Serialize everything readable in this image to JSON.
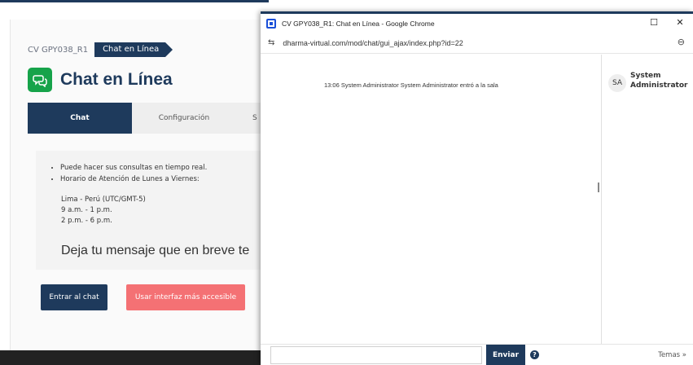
{
  "background_page": {
    "breadcrumb": [
      "CV GPY038_R1",
      "Chat en Línea"
    ],
    "title": "Chat en Línea",
    "tabs": [
      "Chat",
      "Configuración",
      "S"
    ],
    "info_items": [
      "Puede hacer sus consultas en tiempo real.",
      "Horario de Atención de Lunes a Viernes:"
    ],
    "hours": [
      "Lima - Perú (UTC/GMT-5)",
      "9 a.m. - 1 p.m.",
      "2 p.m. - 6 p.m."
    ],
    "big_message": "Deja tu mensaje que en breve te",
    "enter_button": "Entrar al chat",
    "accessible_button": "Usar interfaz más accesible",
    "accent_color": "#1e3a5c",
    "icon_color": "#16a34a",
    "accessible_color": "#f47174"
  },
  "popup": {
    "window_title": "CV GPY038_R1: Chat en Línea - Google Chrome",
    "url": "dharma-virtual.com/mod/chat/gui_ajax/index.php?id=22",
    "message": "13:06 System Administrator System Administrator entró a la sala",
    "users": [
      {
        "initials": "SA",
        "name": "System Administrator"
      }
    ],
    "input_value": "",
    "send_label": "Enviar",
    "themes_label": "Temas »"
  }
}
